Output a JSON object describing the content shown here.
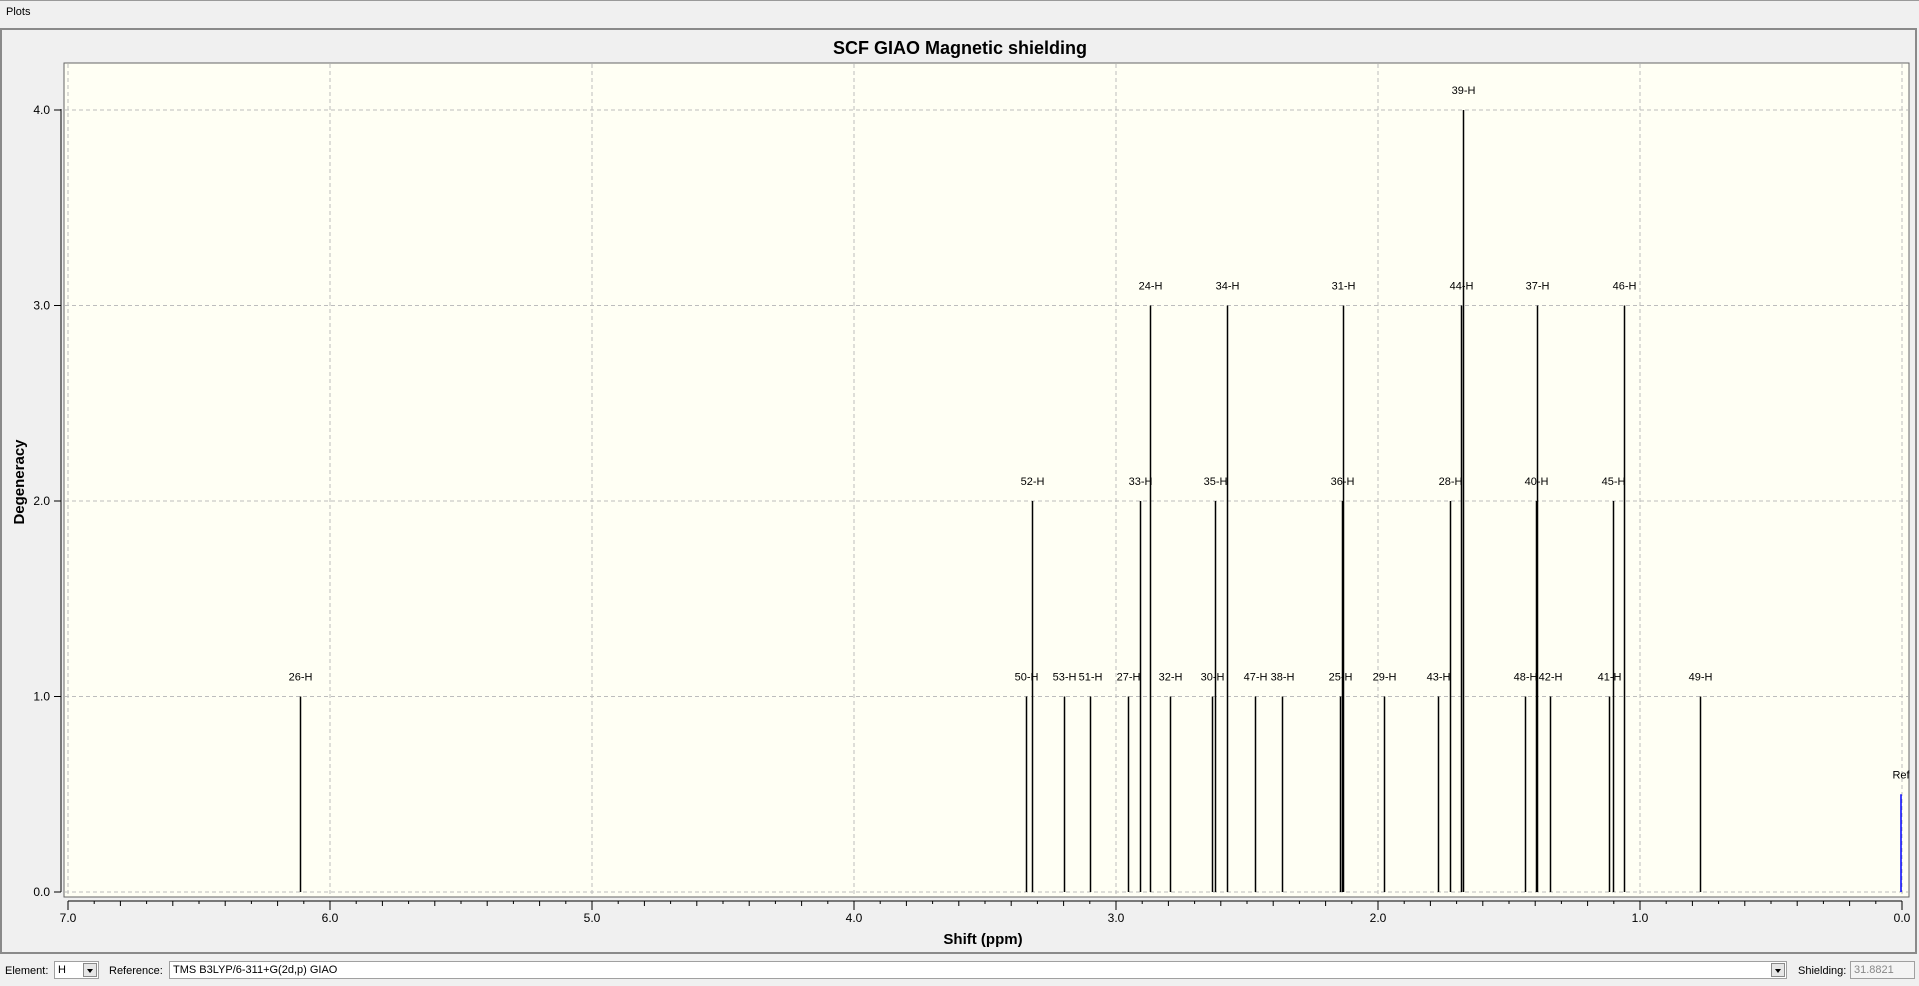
{
  "window": {
    "tab_label": "Plots"
  },
  "chart_data": {
    "type": "bar",
    "title": "SCF GIAO Magnetic shielding",
    "xlabel": "Shift (ppm)",
    "ylabel": "Degeneracy",
    "xlim": [
      7.0,
      0.0
    ],
    "ylim": [
      0.0,
      4.2
    ],
    "x_ticks": [
      "7.0",
      "6.0",
      "5.0",
      "4.0",
      "3.0",
      "2.0",
      "1.0",
      "0.0"
    ],
    "y_ticks": [
      "0.0",
      "1.0",
      "2.0",
      "3.0",
      "4.0"
    ],
    "grid": true,
    "colors": {
      "peak": "#000000",
      "reference": "#0000ff",
      "plot_bg": "#fffff4",
      "grid": "#bdbdbd"
    },
    "peaks": [
      {
        "label": "26-H",
        "shift": 6.116,
        "degeneracy": 1
      },
      {
        "label": "50-H",
        "shift": 3.343,
        "degeneracy": 1
      },
      {
        "label": "52-H",
        "shift": 3.32,
        "degeneracy": 2
      },
      {
        "label": "53-H",
        "shift": 3.198,
        "degeneracy": 1
      },
      {
        "label": "51-H",
        "shift": 3.1,
        "degeneracy": 1
      },
      {
        "label": "27-H",
        "shift": 2.955,
        "degeneracy": 1
      },
      {
        "label": "33-H",
        "shift": 2.908,
        "degeneracy": 2
      },
      {
        "label": "24-H",
        "shift": 2.871,
        "degeneracy": 3
      },
      {
        "label": "32-H",
        "shift": 2.792,
        "degeneracy": 1
      },
      {
        "label": "30-H",
        "shift": 2.633,
        "degeneracy": 1
      },
      {
        "label": "35-H",
        "shift": 2.623,
        "degeneracy": 2
      },
      {
        "label": "34-H",
        "shift": 2.576,
        "degeneracy": 3
      },
      {
        "label": "47-H",
        "shift": 2.469,
        "degeneracy": 1
      },
      {
        "label": "38-H",
        "shift": 2.366,
        "degeneracy": 1
      },
      {
        "label": "25-H",
        "shift": 2.146,
        "degeneracy": 1
      },
      {
        "label": "36-H",
        "shift": 2.137,
        "degeneracy": 2
      },
      {
        "label": "31-H",
        "shift": 2.132,
        "degeneracy": 3
      },
      {
        "label": "29-H",
        "shift": 1.978,
        "degeneracy": 1
      },
      {
        "label": "43-H",
        "shift": 1.772,
        "degeneracy": 1
      },
      {
        "label": "28-H",
        "shift": 1.725,
        "degeneracy": 2
      },
      {
        "label": "44-H",
        "shift": 1.683,
        "degeneracy": 3
      },
      {
        "label": "39-H",
        "shift": 1.674,
        "degeneracy": 4
      },
      {
        "label": "48-H",
        "shift": 1.44,
        "degeneracy": 1
      },
      {
        "label": "40-H",
        "shift": 1.398,
        "degeneracy": 2
      },
      {
        "label": "37-H",
        "shift": 1.393,
        "degeneracy": 3
      },
      {
        "label": "42-H",
        "shift": 1.342,
        "degeneracy": 1
      },
      {
        "label": "41-H",
        "shift": 1.118,
        "degeneracy": 1
      },
      {
        "label": "45-H",
        "shift": 1.104,
        "degeneracy": 2
      },
      {
        "label": "46-H",
        "shift": 1.061,
        "degeneracy": 3
      },
      {
        "label": "49-H",
        "shift": 0.772,
        "degeneracy": 1
      }
    ],
    "reference": {
      "label": "Ref",
      "shift": 0.0,
      "degeneracy": 0.5
    }
  },
  "controls": {
    "element_label": "Element:",
    "element_value": "H",
    "reference_label": "Reference:",
    "reference_value": "TMS B3LYP/6-311+G(2d,p) GIAO",
    "shielding_label": "Shielding:",
    "shielding_value": "31.8821"
  }
}
